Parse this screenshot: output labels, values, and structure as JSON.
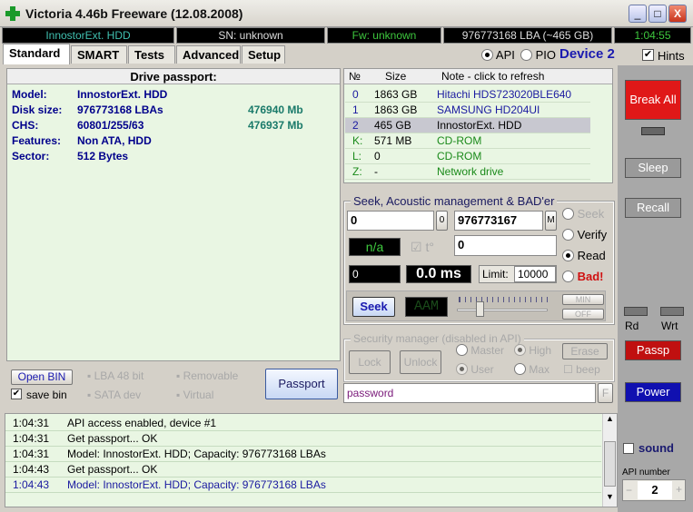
{
  "window": {
    "title": "Victoria 4.46b Freeware (12.08.2008)",
    "minimize": "_",
    "maximize": "□",
    "close": "X"
  },
  "status": {
    "model": "InnostorExt. HDD",
    "sn": "SN: unknown",
    "fw": "Fw: unknown",
    "lba": "976773168 LBA (~465 GB)",
    "time": "1:04:55"
  },
  "tabs": [
    "Standard",
    "SMART",
    "Tests",
    "Advanced",
    "Setup"
  ],
  "mode": {
    "api": "API",
    "pio": "PIO",
    "device": "Device 2",
    "hints": "Hints",
    "api_selected": true,
    "hints_checked": true
  },
  "passport": {
    "header": "Drive passport:",
    "rows": [
      {
        "label": "Model:",
        "value": "InnostorExt. HDD",
        "extra": ""
      },
      {
        "label": "Disk size:",
        "value": "976773168 LBAs",
        "extra": "476940 Mb"
      },
      {
        "label": "CHS:",
        "value": "60801/255/63",
        "extra": "476937 Mb"
      },
      {
        "label": "Features:",
        "value": "Non ATA, HDD",
        "extra": ""
      },
      {
        "label": "Sector:",
        "value": "512 Bytes",
        "extra": ""
      }
    ]
  },
  "passport_controls": {
    "open_bin": "Open BIN",
    "save_bin": "save bin",
    "lba48": "LBA 48 bit",
    "removable": "Removable",
    "sata": "SATA dev",
    "virtual": "Virtual",
    "passport": "Passport"
  },
  "drives": {
    "headers": [
      "№",
      "Size",
      "Note - click to refresh"
    ],
    "rows": [
      {
        "n": "0",
        "size": "1863 GB",
        "note": "Hitachi HDS723020BLE640"
      },
      {
        "n": "1",
        "size": "1863 GB",
        "note": "SAMSUNG HD204UI"
      },
      {
        "n": "2",
        "size": "465 GB",
        "note": "InnostorExt. HDD"
      },
      {
        "n": "K:",
        "size": "571 MB",
        "note": "CD-ROM"
      },
      {
        "n": "L:",
        "size": "0",
        "note": "CD-ROM"
      },
      {
        "n": "Z:",
        "size": "-",
        "note": "Network drive"
      }
    ]
  },
  "seek": {
    "title": "Seek, Acoustic management & BAD'er",
    "start": "0",
    "start_btn": "0",
    "end": "976773167",
    "end_btn": "M",
    "temp": "n/a",
    "t_label": "t°",
    "field2": "0",
    "counter": "0",
    "ms": "0.0 ms",
    "limit_label": "Limit:",
    "limit": "10000",
    "modes": [
      "Seek",
      "Verify",
      "Read",
      "Bad!"
    ],
    "selected_mode": "Read",
    "seek_btn": "Seek",
    "aam": "AAM",
    "min": "MIN",
    "off": "OFF"
  },
  "security": {
    "title": "Security manager (disabled in API)",
    "lock": "Lock",
    "unlock": "Unlock",
    "master": "Master",
    "high": "High",
    "user": "User",
    "max": "Max",
    "erase": "Erase",
    "beep": "beep",
    "password": "password",
    "f": "F"
  },
  "log": [
    {
      "time": "1:04:31",
      "text": "API access enabled, device #1",
      "color": "#000000"
    },
    {
      "time": "1:04:31",
      "text": "Get passport... OK",
      "color": "#000000"
    },
    {
      "time": "1:04:31",
      "text": "Model: InnostorExt. HDD; Capacity: 976773168 LBAs",
      "color": "#000000"
    },
    {
      "time": "1:04:43",
      "text": "Get passport... OK",
      "color": "#000000"
    },
    {
      "time": "1:04:43",
      "text": "Model: InnostorExt. HDD; Capacity: 976773168 LBAs",
      "color": "#1a1aa0"
    }
  ],
  "side": {
    "break_all": "Break All",
    "sleep": "Sleep",
    "recall": "Recall",
    "rd": "Rd",
    "wrt": "Wrt",
    "passp": "Passp",
    "power": "Power",
    "sound": "sound",
    "api_number_label": "API number",
    "api_number": "2",
    "minus": "−",
    "plus": "+"
  }
}
